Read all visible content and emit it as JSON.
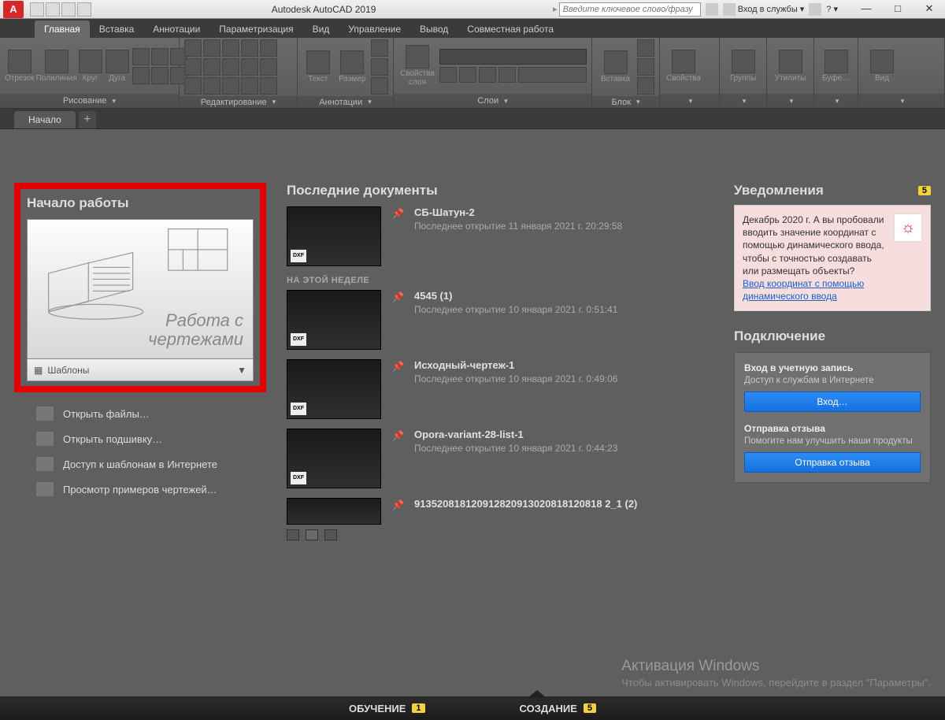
{
  "app": {
    "title": "Autodesk AutoCAD 2019",
    "logo_letter": "A"
  },
  "titlebar": {
    "search_placeholder": "Введите ключевое слово/фразу",
    "signin": "Вход в службы"
  },
  "menus": [
    "Главная",
    "Вставка",
    "Аннотации",
    "Параметризация",
    "Вид",
    "Управление",
    "Вывод",
    "Совместная работа"
  ],
  "ribbon": {
    "draw": {
      "label": "Рисование",
      "items": [
        "Отрезок",
        "Полилиния",
        "Круг",
        "Дуга"
      ]
    },
    "edit": {
      "label": "Редактирование"
    },
    "anno": {
      "label": "Аннотации",
      "items": [
        "Текст",
        "Размер"
      ]
    },
    "layers": {
      "label": "Слои",
      "props": "Свойства слоя"
    },
    "block": {
      "label": "Блок",
      "insert": "Вставка"
    },
    "props": "Свойства",
    "groups": "Группы",
    "util": "Утилиты",
    "clip": "Буфе…",
    "view": "Вид"
  },
  "tabs": {
    "start": "Начало"
  },
  "left": {
    "title": "Начало работы",
    "card_line1": "Работа с",
    "card_line2": "чертежами",
    "templates": "Шаблоны",
    "links": [
      "Открыть файлы…",
      "Открыть подшивку…",
      "Доступ к шаблонам в Интернете",
      "Просмотр примеров чертежей…"
    ]
  },
  "mid": {
    "title": "Последние документы",
    "week": "НА ЭТОЙ НЕДЕЛЕ",
    "docs": [
      {
        "name": "СБ-Шатун-2",
        "sub": "Последнее открытие 11 января 2021 г. 20:29:58"
      },
      {
        "name": "4545 (1)",
        "sub": "Последнее открытие 10 января 2021 г. 0:51:41"
      },
      {
        "name": "Исходный-чертеж-1",
        "sub": "Последнее открытие 10 января 2021 г. 0:49:06"
      },
      {
        "name": "Opora-variant-28-list-1",
        "sub": "Последнее открытие 10 января 2021 г. 0:44:23"
      },
      {
        "name": "913520818120912820913020818120818 2_1 (2)",
        "sub": ""
      }
    ]
  },
  "right": {
    "notif_title": "Уведомления",
    "notif_count": "5",
    "notif_body": "Декабрь 2020 г. А вы пробовали вводить значение координат с помощью динамического ввода, чтобы с точностью создавать или размещать объекты?",
    "notif_link": "Ввод координат с помощью динамического ввода",
    "conn_title": "Подключение",
    "signin_title": "Вход в учетную запись",
    "signin_sub": "Доступ к службам в Интернете",
    "signin_btn": "Вход…",
    "feedback_title": "Отправка отзыва",
    "feedback_sub": "Помогите нам улучшить наши продукты",
    "feedback_btn": "Отправка отзыва"
  },
  "watermark": {
    "title": "Активация Windows",
    "body": "Чтобы активировать Windows, перейдите в раздел \"Параметры\"."
  },
  "bottom": {
    "learn": "ОБУЧЕНИЕ",
    "learn_n": "1",
    "create": "СОЗДАНИЕ",
    "create_n": "5"
  }
}
